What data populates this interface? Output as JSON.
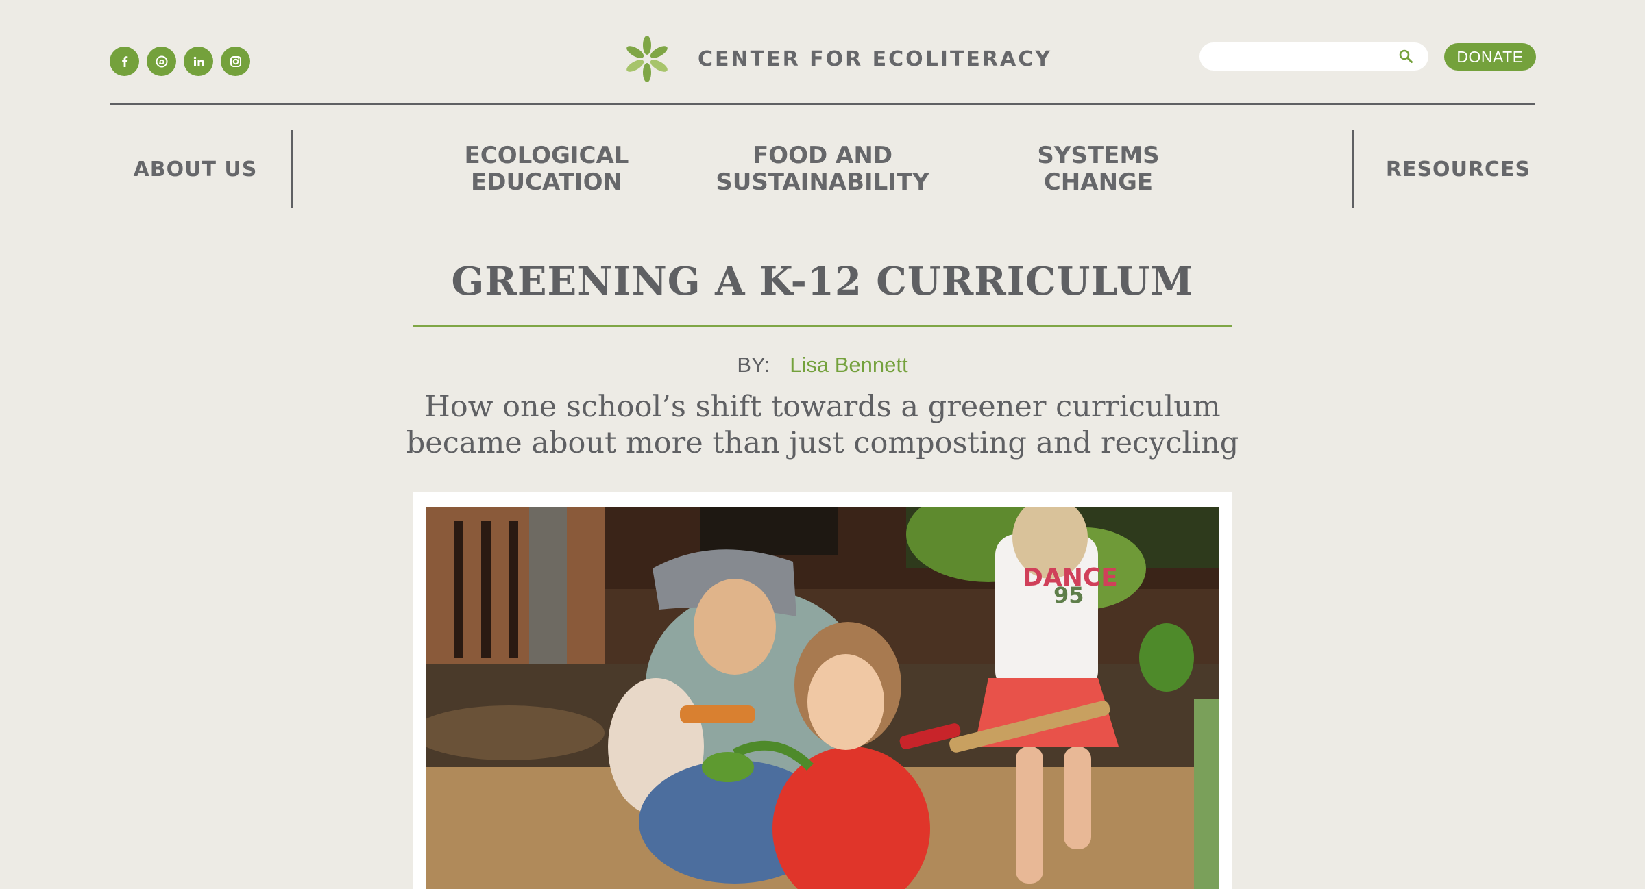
{
  "header": {
    "social": [
      {
        "name": "facebook-icon"
      },
      {
        "name": "threads-icon"
      },
      {
        "name": "linkedin-icon"
      },
      {
        "name": "instagram-icon"
      }
    ],
    "brand_name": "CENTER FOR ECOLITERACY",
    "search": {
      "value": "",
      "placeholder": ""
    },
    "donate_label": "DONATE",
    "accent_color": "#74a13c"
  },
  "nav": {
    "about": "ABOUT US",
    "ecological": "ECOLOGICAL\nEDUCATION",
    "food": "FOOD AND\nSUSTAINABILITY",
    "systems": "SYSTEMS\nCHANGE",
    "resources": "RESOURCES"
  },
  "article": {
    "title": "GREENING A K-12 CURRICULUM",
    "byline_label": "BY:",
    "author": "Lisa Bennett",
    "subtitle": "How one school’s shift towards a greener curriculum became about more than just composting and recycling"
  }
}
